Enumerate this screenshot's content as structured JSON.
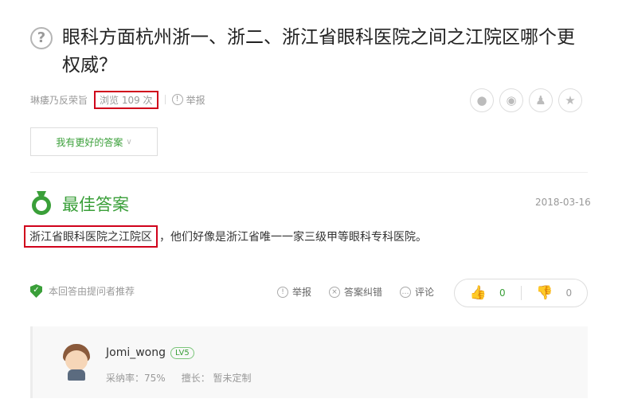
{
  "question": {
    "icon": "question-circle-icon",
    "title": "眼科方面杭州浙一、浙二、浙江省眼科医院之间之江院区哪个更权威？"
  },
  "meta": {
    "user": "琳痿乃反荣旨",
    "views": "浏览 109 次",
    "report": "举报"
  },
  "share": {
    "icons": [
      "wechat-icon",
      "weibo-icon",
      "qq-icon",
      "favorite-star-icon"
    ]
  },
  "better_answer_button": "我有更好的答案",
  "best_answer": {
    "title": "最佳答案",
    "date": "2018-03-16",
    "highlight": "浙江省眼科医院之江院区",
    "text": "，他们好像是浙江省唯一一家三级甲等眼科专科医院。",
    "recommend": "本回答由提问者推荐",
    "actions": {
      "report": "举报",
      "correct": "答案纠错",
      "comment": "评论"
    },
    "votes": {
      "up": "0",
      "down": "0"
    }
  },
  "answerer": {
    "name": "Jomi_wong",
    "level": "LV5",
    "adoption_rate": "采纳率：75%",
    "specialty": "擅长：  暂未定制"
  },
  "colors": {
    "accent_green": "#3a9f39",
    "highlight_red": "#d0021b"
  }
}
